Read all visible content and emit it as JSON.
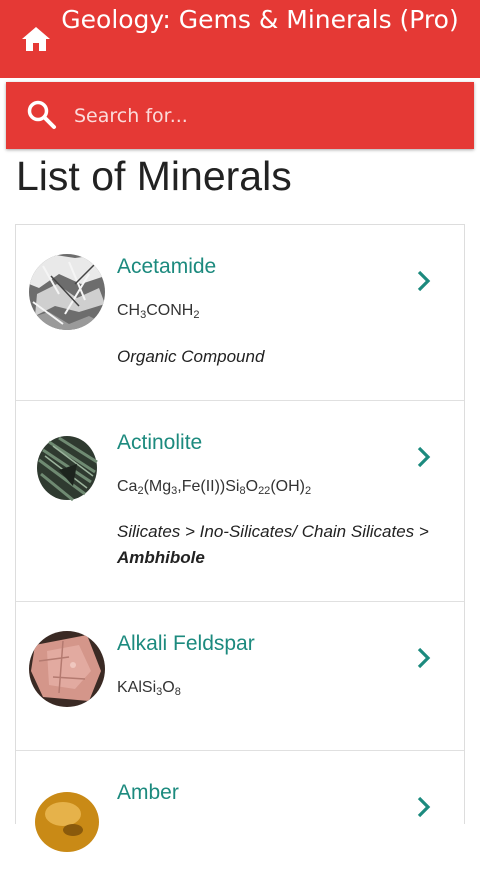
{
  "appbar": {
    "title": "Geology: Gems & Minerals (Pro)"
  },
  "search": {
    "placeholder": "Search for..."
  },
  "page": {
    "title": "List of Minerals"
  },
  "minerals": [
    {
      "name": "Acetamide",
      "formula_parts": [
        "CH",
        "3",
        "CONH",
        "2"
      ],
      "category": "Organic Compound",
      "category_bold": ""
    },
    {
      "name": "Actinolite",
      "formula_parts": [
        "Ca",
        "2",
        "(Mg",
        "3",
        ",Fe(II))Si",
        "8",
        "O",
        "22",
        "(OH)",
        "2"
      ],
      "category": "Silicates > Ino-Silicates/ Chain Silicates > ",
      "category_bold": "Ambhibole"
    },
    {
      "name": "Alkali Feldspar",
      "formula_parts": [
        "KAlSi",
        "3",
        "O",
        "8"
      ],
      "category": "",
      "category_bold": ""
    },
    {
      "name": "Amber",
      "formula_parts": [],
      "category": "",
      "category_bold": ""
    }
  ],
  "colors": {
    "accent": "#e53935",
    "link": "#1c8a7e"
  },
  "icons": {
    "home": "home-icon",
    "search": "search-icon",
    "chevron": "chevron-right-icon"
  }
}
